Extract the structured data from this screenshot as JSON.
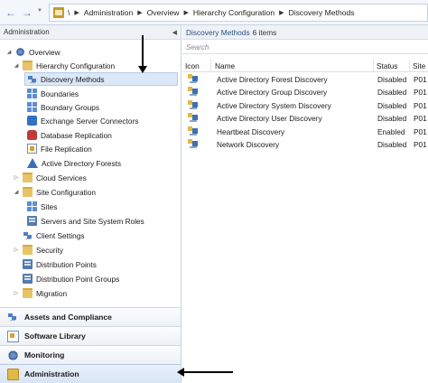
{
  "breadcrumb": {
    "root": "\\",
    "items": [
      "Administration",
      "Overview",
      "Hierarchy Configuration",
      "Discovery Methods"
    ]
  },
  "left": {
    "header": "Administration",
    "tree": [
      {
        "label": "Overview",
        "icon": "gear-icon"
      },
      {
        "label": "Hierarchy Configuration",
        "icon": "folder-icon"
      },
      {
        "label": "Discovery Methods",
        "icon": "computers-icon"
      },
      {
        "label": "Boundaries",
        "icon": "boundaries-icon"
      },
      {
        "label": "Boundary Groups",
        "icon": "boundary-groups-icon"
      },
      {
        "label": "Exchange Server Connectors",
        "icon": "exchange-icon"
      },
      {
        "label": "Database Replication",
        "icon": "database-icon"
      },
      {
        "label": "File Replication",
        "icon": "document-icon"
      },
      {
        "label": "Active Directory Forests",
        "icon": "forest-icon"
      },
      {
        "label": "Cloud Services",
        "icon": "folder-icon"
      },
      {
        "label": "Site Configuration",
        "icon": "folder-icon"
      },
      {
        "label": "Sites",
        "icon": "sites-icon"
      },
      {
        "label": "Servers and Site System Roles",
        "icon": "server-icon"
      },
      {
        "label": "Client Settings",
        "icon": "client-settings-icon"
      },
      {
        "label": "Security",
        "icon": "folder-icon"
      },
      {
        "label": "Distribution Points",
        "icon": "distribution-point-icon"
      },
      {
        "label": "Distribution Point Groups",
        "icon": "distribution-group-icon"
      },
      {
        "label": "Migration",
        "icon": "folder-icon"
      }
    ],
    "workspaces": [
      "Assets and Compliance",
      "Software Library",
      "Monitoring",
      "Administration"
    ]
  },
  "right": {
    "title": "Discovery Methods",
    "count": "6 items",
    "search_placeholder": "Search",
    "columns": [
      "Icon",
      "Name",
      "Status",
      "Site"
    ],
    "rows": [
      {
        "name": "Active Directory Forest Discovery",
        "status": "Disabled",
        "site": "P01"
      },
      {
        "name": "Active Directory Group Discovery",
        "status": "Disabled",
        "site": "P01"
      },
      {
        "name": "Active Directory System Discovery",
        "status": "Disabled",
        "site": "P01"
      },
      {
        "name": "Active Directory User Discovery",
        "status": "Disabled",
        "site": "P01"
      },
      {
        "name": "Heartbeat Discovery",
        "status": "Enabled",
        "site": "P01"
      },
      {
        "name": "Network Discovery",
        "status": "Disabled",
        "site": "P01"
      }
    ]
  },
  "colors": {
    "selection": "#dbe8f7",
    "header_text": "#2b4f7e",
    "accent_blue": "#3d6fb8"
  }
}
